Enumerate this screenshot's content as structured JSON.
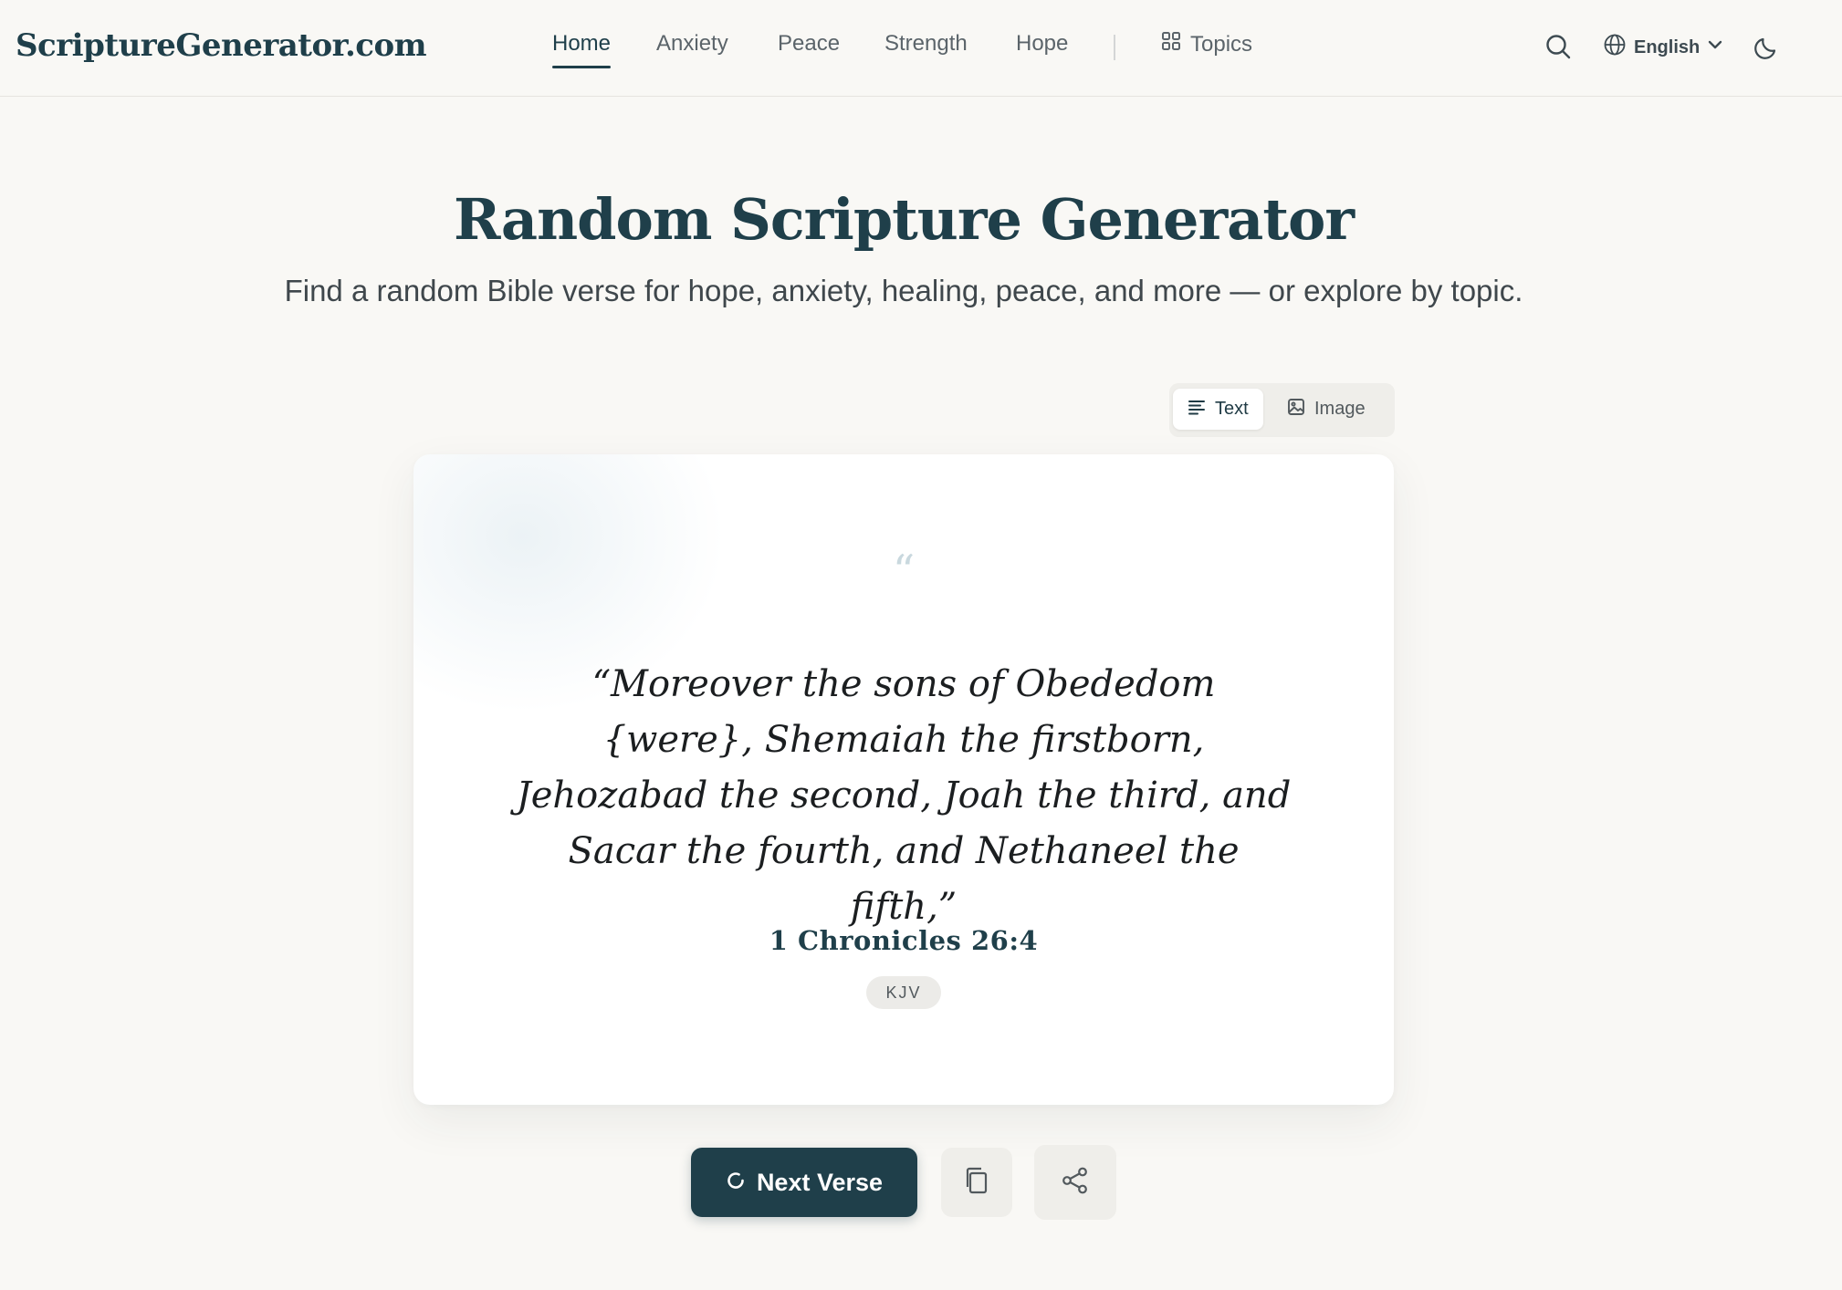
{
  "header": {
    "logo": "ScriptureGenerator.com",
    "nav": [
      {
        "label": "Home",
        "active": true
      },
      {
        "label": "Anxiety",
        "active": false
      },
      {
        "label": "Peace",
        "active": false
      },
      {
        "label": "Strength",
        "active": false
      },
      {
        "label": "Hope",
        "active": false
      }
    ],
    "topics_label": "Topics",
    "language_label": "English",
    "icons": {
      "search": "search-icon",
      "language": "globe-icon",
      "dropdown": "chevron-down-icon",
      "theme": "moon-icon",
      "topics": "grid-icon"
    }
  },
  "hero": {
    "title": "Random Scripture Generator",
    "subtitle": "Find a random Bible verse for hope, anxiety, healing, peace, and more — or explore by topic."
  },
  "view_toggle": {
    "options": [
      {
        "label": "Text",
        "icon": "text-lines-icon",
        "active": true
      },
      {
        "label": "Image",
        "icon": "image-icon",
        "active": false
      }
    ]
  },
  "verse_card": {
    "quote_mark": "“",
    "text": "“Moreover the sons of Obededom {were}, Shemaiah the firstborn, Jehozabad the second, Joah the third, and Sacar the fourth, and Nethaneel the fifth,”",
    "reference": "1 Chronicles 26:4",
    "version": "KJV"
  },
  "actions": {
    "next_label": "Next Verse",
    "next_icon": "refresh-icon",
    "copy_icon": "copy-icon",
    "share_icon": "share-icon"
  },
  "colors": {
    "brand": "#1f3f4a",
    "background": "#f9f8f5",
    "card": "#ffffff",
    "muted_button": "#efeeea"
  }
}
